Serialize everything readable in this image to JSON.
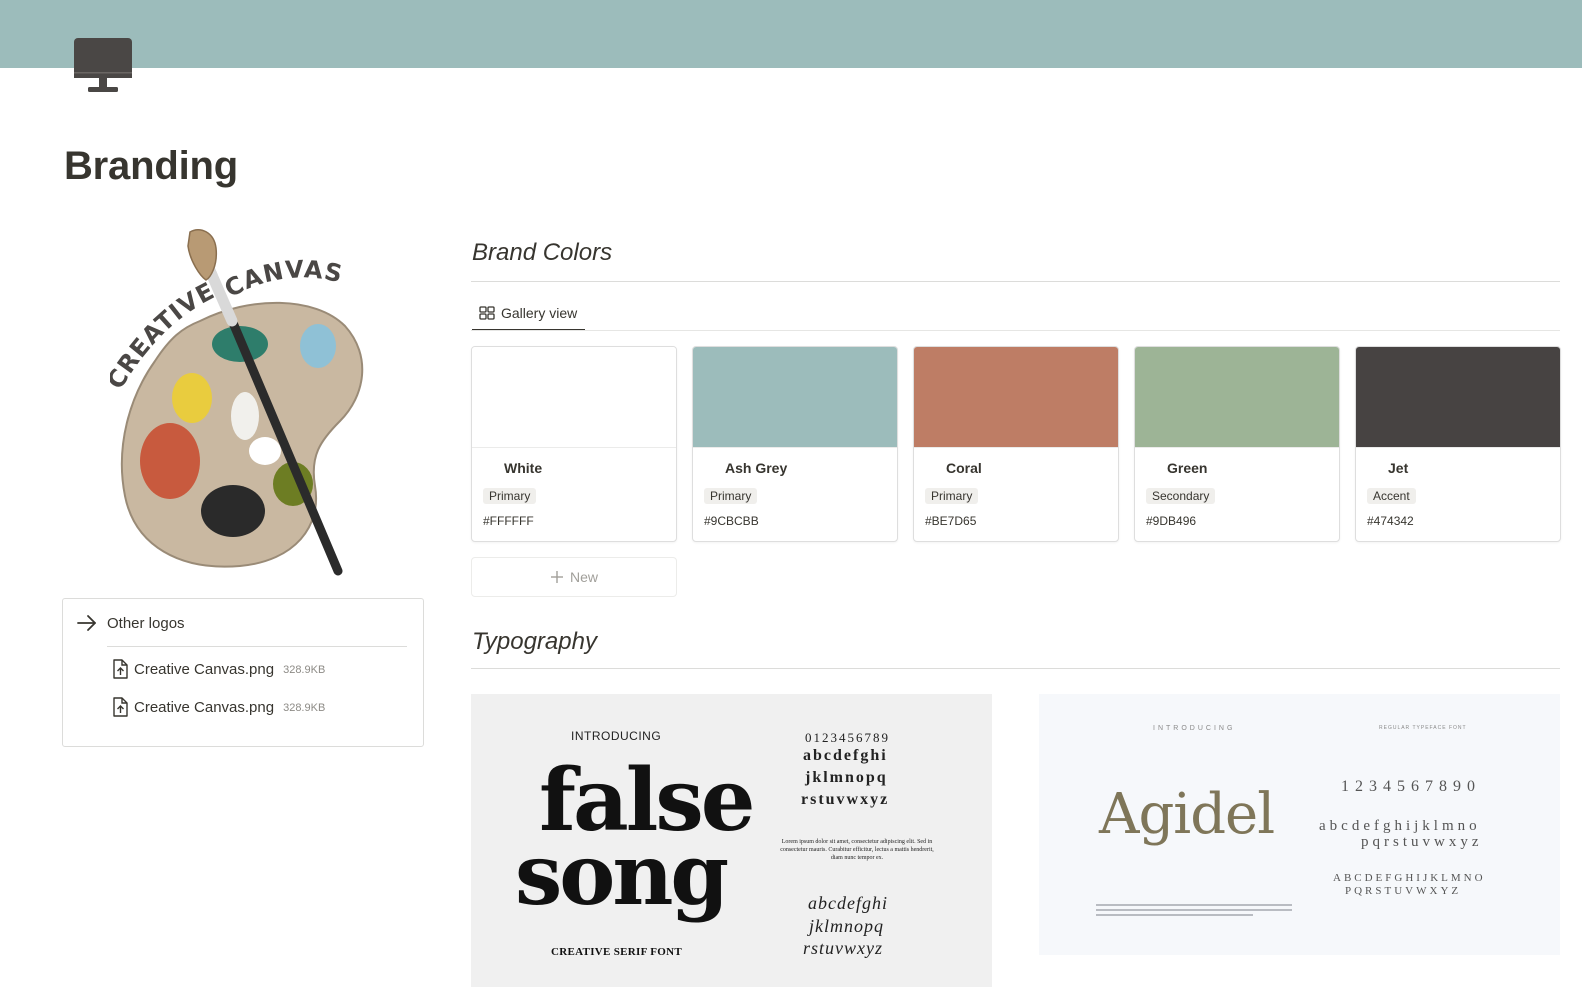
{
  "cover": {
    "color": "#9CBCBB"
  },
  "page": {
    "icon": "desktop-computer-icon",
    "title": "Branding"
  },
  "logo": {
    "text_line1": "CREATIVE",
    "text_line2": "CANVAS"
  },
  "other_logos": {
    "label": "Other logos",
    "files": [
      {
        "name": "Creative Canvas.png",
        "size": "328.9KB"
      },
      {
        "name": "Creative Canvas.png",
        "size": "328.9KB"
      }
    ]
  },
  "brand_colors": {
    "title": "Brand Colors",
    "view_tab": "Gallery view",
    "cards": [
      {
        "name": "White",
        "tag": "Primary",
        "hex": "#FFFFFF"
      },
      {
        "name": "Ash Grey",
        "tag": "Primary",
        "hex": "#9CBCBB"
      },
      {
        "name": "Coral",
        "tag": "Primary",
        "hex": "#BE7D65"
      },
      {
        "name": "Green",
        "tag": "Secondary",
        "hex": "#9DB496"
      },
      {
        "name": "Jet",
        "tag": "Accent",
        "hex": "#474342"
      }
    ],
    "new_label": "New"
  },
  "typography": {
    "title": "Typography",
    "font1": {
      "intro": "INTRODUCING",
      "name_line1": "false",
      "name_line2": "song",
      "subtitle": "CREATIVE SERIF FONT",
      "digits": "0123456789",
      "lower1": "abcdefghi",
      "lower2": "jklmnopq",
      "lower3": "rstuvwxyz",
      "lorem": "Lorem ipsum dolor sit amet, consectetur adipiscing elit. Sed in consectetur mauris. Curabitur efficitur, lectus a mattis hendrerit, diam nunc tempor ex.",
      "alt1": "abcdefghi",
      "alt2": "jklmnopq",
      "alt3": "rstuvwxyz"
    },
    "font2": {
      "intro": "INTRODUCING",
      "kind": "REGULAR TYPEFACE FONT",
      "name": "Agidel",
      "digits": "1234567890",
      "lower1": "abcdefghijklmno",
      "lower2": "pqrstuvwxyz",
      "upper1": "ABCDEFGHIJKLMNO",
      "upper2": "PQRSTUVWXYZ"
    }
  }
}
